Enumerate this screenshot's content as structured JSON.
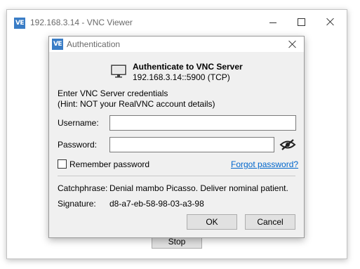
{
  "main_window": {
    "title": "192.168.3.14 - VNC Viewer",
    "logo_text": "VE",
    "stop_label": "Stop"
  },
  "dialog": {
    "title": "Authentication",
    "logo_text": "VE",
    "header_title": "Authenticate to VNC Server",
    "header_address": "192.168.3.14::5900 (TCP)",
    "instructions_line1": "Enter VNC Server credentials",
    "instructions_line2": "(Hint: NOT your RealVNC account details)",
    "username_label": "Username:",
    "username_value": "",
    "password_label": "Password:",
    "password_value": "",
    "remember_label": "Remember password",
    "remember_checked": false,
    "forgot_link": "Forgot password?",
    "catchphrase_label": "Catchphrase:",
    "catchphrase_value": "Denial mambo Picasso. Deliver nominal patient.",
    "signature_label": "Signature:",
    "signature_value": "d8-a7-eb-58-98-03-a3-98",
    "ok_label": "OK",
    "cancel_label": "Cancel"
  },
  "icons": {
    "app_logo": "vnc-logo-icon",
    "minimize": "minimize-icon",
    "maximize": "maximize-icon",
    "close": "close-icon",
    "monitor": "monitor-icon",
    "reveal_password": "eye-slash-icon"
  },
  "colors": {
    "logo": "#3a7dc6",
    "link": "#0066cc",
    "dialog_bg": "#f0f0f0",
    "button_bg": "#e1e1e1"
  }
}
